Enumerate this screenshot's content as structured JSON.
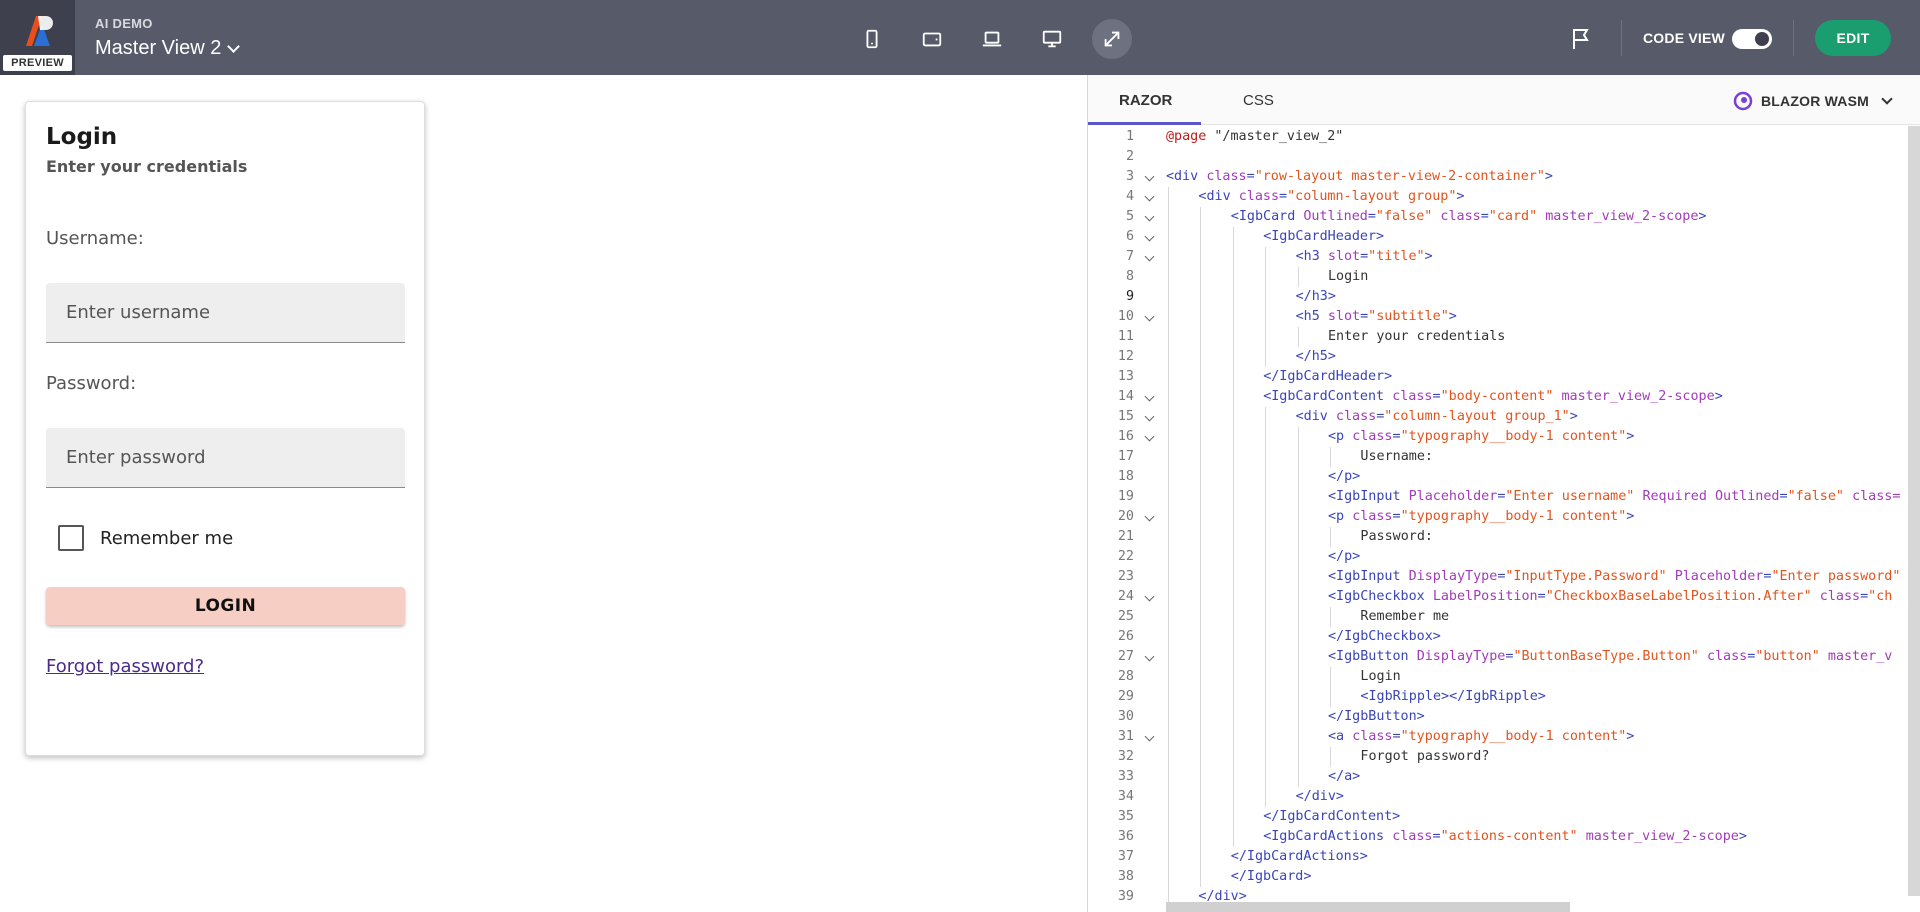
{
  "app": {
    "name": "AI DEMO",
    "view_title": "Master View 2",
    "badge": "PREVIEW"
  },
  "toolbar": {
    "devices": [
      "phone-icon",
      "tablet-icon",
      "laptop-icon",
      "desktop-icon",
      "fullscreen-icon"
    ],
    "active_device": "fullscreen-icon",
    "code_view_label": "CODE VIEW",
    "code_view_on": true,
    "edit_label": "EDIT"
  },
  "card": {
    "title": "Login",
    "subtitle": "Enter your credentials",
    "username_label": "Username:",
    "username_placeholder": "Enter username",
    "password_label": "Password:",
    "password_placeholder": "Enter password",
    "remember_label": "Remember me",
    "login_label": "LOGIN",
    "forgot_label": "Forgot password?"
  },
  "code": {
    "tabs": [
      {
        "label": "RAZOR",
        "active": true
      },
      {
        "label": "CSS",
        "active": false
      }
    ],
    "framework": "BLAZOR WASM",
    "current_line": 9,
    "lines": [
      {
        "n": 1,
        "indent": 0,
        "fold": false,
        "t": [
          [
            "dir",
            "@page"
          ],
          [
            "plain",
            " "
          ],
          [
            "plain",
            "\"/master_view_2\""
          ]
        ]
      },
      {
        "n": 2,
        "indent": 0,
        "fold": false,
        "t": []
      },
      {
        "n": 3,
        "indent": 0,
        "fold": true,
        "t": [
          [
            "tag",
            "<div "
          ],
          [
            "attr",
            "class"
          ],
          [
            "tag",
            "="
          ],
          [
            "str",
            "\"row-layout master-view-2-container\""
          ],
          [
            "tag",
            ">"
          ]
        ]
      },
      {
        "n": 4,
        "indent": 1,
        "fold": true,
        "t": [
          [
            "tag",
            "<div "
          ],
          [
            "attr",
            "class"
          ],
          [
            "tag",
            "="
          ],
          [
            "str",
            "\"column-layout group\""
          ],
          [
            "tag",
            ">"
          ]
        ]
      },
      {
        "n": 5,
        "indent": 2,
        "fold": true,
        "t": [
          [
            "tag",
            "<IgbCard "
          ],
          [
            "attr",
            "Outlined"
          ],
          [
            "tag",
            "="
          ],
          [
            "str",
            "\"false\""
          ],
          [
            "tag",
            " "
          ],
          [
            "attr",
            "class"
          ],
          [
            "tag",
            "="
          ],
          [
            "str",
            "\"card\""
          ],
          [
            "tag",
            " "
          ],
          [
            "attr",
            "master_view_2-scope"
          ],
          [
            "tag",
            ">"
          ]
        ]
      },
      {
        "n": 6,
        "indent": 3,
        "fold": true,
        "t": [
          [
            "tag",
            "<IgbCardHeader>"
          ]
        ]
      },
      {
        "n": 7,
        "indent": 4,
        "fold": true,
        "t": [
          [
            "tag",
            "<h3 "
          ],
          [
            "attr",
            "slot"
          ],
          [
            "tag",
            "="
          ],
          [
            "str",
            "\"title\""
          ],
          [
            "tag",
            ">"
          ]
        ]
      },
      {
        "n": 8,
        "indent": 5,
        "fold": false,
        "t": [
          [
            "plain",
            "Login"
          ]
        ]
      },
      {
        "n": 9,
        "indent": 4,
        "fold": false,
        "t": [
          [
            "tag",
            "</h3>"
          ]
        ]
      },
      {
        "n": 10,
        "indent": 4,
        "fold": true,
        "t": [
          [
            "tag",
            "<h5 "
          ],
          [
            "attr",
            "slot"
          ],
          [
            "tag",
            "="
          ],
          [
            "str",
            "\"subtitle\""
          ],
          [
            "tag",
            ">"
          ]
        ]
      },
      {
        "n": 11,
        "indent": 5,
        "fold": false,
        "t": [
          [
            "plain",
            "Enter your credentials"
          ]
        ]
      },
      {
        "n": 12,
        "indent": 4,
        "fold": false,
        "t": [
          [
            "tag",
            "</h5>"
          ]
        ]
      },
      {
        "n": 13,
        "indent": 3,
        "fold": false,
        "t": [
          [
            "tag",
            "</IgbCardHeader>"
          ]
        ]
      },
      {
        "n": 14,
        "indent": 3,
        "fold": true,
        "t": [
          [
            "tag",
            "<IgbCardContent "
          ],
          [
            "attr",
            "class"
          ],
          [
            "tag",
            "="
          ],
          [
            "str",
            "\"body-content\""
          ],
          [
            "tag",
            " "
          ],
          [
            "attr",
            "master_view_2-scope"
          ],
          [
            "tag",
            ">"
          ]
        ]
      },
      {
        "n": 15,
        "indent": 4,
        "fold": true,
        "t": [
          [
            "tag",
            "<div "
          ],
          [
            "attr",
            "class"
          ],
          [
            "tag",
            "="
          ],
          [
            "str",
            "\"column-layout group_1\""
          ],
          [
            "tag",
            ">"
          ]
        ]
      },
      {
        "n": 16,
        "indent": 5,
        "fold": true,
        "t": [
          [
            "tag",
            "<p "
          ],
          [
            "attr",
            "class"
          ],
          [
            "tag",
            "="
          ],
          [
            "str",
            "\"typography__body-1 content\""
          ],
          [
            "tag",
            ">"
          ]
        ]
      },
      {
        "n": 17,
        "indent": 6,
        "fold": false,
        "t": [
          [
            "plain",
            "Username:"
          ]
        ]
      },
      {
        "n": 18,
        "indent": 5,
        "fold": false,
        "t": [
          [
            "tag",
            "</p>"
          ]
        ]
      },
      {
        "n": 19,
        "indent": 5,
        "fold": false,
        "t": [
          [
            "tag",
            "<IgbInput "
          ],
          [
            "attr",
            "Placeholder"
          ],
          [
            "tag",
            "="
          ],
          [
            "str",
            "\"Enter username\""
          ],
          [
            "tag",
            " "
          ],
          [
            "attr",
            "Required"
          ],
          [
            "tag",
            " "
          ],
          [
            "attr",
            "Outlined"
          ],
          [
            "tag",
            "="
          ],
          [
            "str",
            "\"false\""
          ],
          [
            "tag",
            " "
          ],
          [
            "attr",
            "class="
          ]
        ]
      },
      {
        "n": 20,
        "indent": 5,
        "fold": true,
        "t": [
          [
            "tag",
            "<p "
          ],
          [
            "attr",
            "class"
          ],
          [
            "tag",
            "="
          ],
          [
            "str",
            "\"typography__body-1 content\""
          ],
          [
            "tag",
            ">"
          ]
        ]
      },
      {
        "n": 21,
        "indent": 6,
        "fold": false,
        "t": [
          [
            "plain",
            "Password:"
          ]
        ]
      },
      {
        "n": 22,
        "indent": 5,
        "fold": false,
        "t": [
          [
            "tag",
            "</p>"
          ]
        ]
      },
      {
        "n": 23,
        "indent": 5,
        "fold": false,
        "t": [
          [
            "tag",
            "<IgbInput "
          ],
          [
            "attr",
            "DisplayType"
          ],
          [
            "tag",
            "="
          ],
          [
            "str",
            "\"InputType.Password\""
          ],
          [
            "tag",
            " "
          ],
          [
            "attr",
            "Placeholder"
          ],
          [
            "tag",
            "="
          ],
          [
            "str",
            "\"Enter password\""
          ]
        ]
      },
      {
        "n": 24,
        "indent": 5,
        "fold": true,
        "t": [
          [
            "tag",
            "<IgbCheckbox "
          ],
          [
            "attr",
            "LabelPosition"
          ],
          [
            "tag",
            "="
          ],
          [
            "str",
            "\"CheckboxBaseLabelPosition.After\""
          ],
          [
            "tag",
            " "
          ],
          [
            "attr",
            "class"
          ],
          [
            "tag",
            "="
          ],
          [
            "str",
            "\"ch"
          ]
        ]
      },
      {
        "n": 25,
        "indent": 6,
        "fold": false,
        "t": [
          [
            "plain",
            "Remember me"
          ]
        ]
      },
      {
        "n": 26,
        "indent": 5,
        "fold": false,
        "t": [
          [
            "tag",
            "</IgbCheckbox>"
          ]
        ]
      },
      {
        "n": 27,
        "indent": 5,
        "fold": true,
        "t": [
          [
            "tag",
            "<IgbButton "
          ],
          [
            "attr",
            "DisplayType"
          ],
          [
            "tag",
            "="
          ],
          [
            "str",
            "\"ButtonBaseType.Button\""
          ],
          [
            "tag",
            " "
          ],
          [
            "attr",
            "class"
          ],
          [
            "tag",
            "="
          ],
          [
            "str",
            "\"button\""
          ],
          [
            "tag",
            " "
          ],
          [
            "attr",
            "master_v"
          ]
        ]
      },
      {
        "n": 28,
        "indent": 6,
        "fold": false,
        "t": [
          [
            "plain",
            "Login"
          ]
        ]
      },
      {
        "n": 29,
        "indent": 6,
        "fold": false,
        "t": [
          [
            "tag",
            "<IgbRipple></IgbRipple>"
          ]
        ]
      },
      {
        "n": 30,
        "indent": 5,
        "fold": false,
        "t": [
          [
            "tag",
            "</IgbButton>"
          ]
        ]
      },
      {
        "n": 31,
        "indent": 5,
        "fold": true,
        "t": [
          [
            "tag",
            "<a "
          ],
          [
            "attr",
            "class"
          ],
          [
            "tag",
            "="
          ],
          [
            "str",
            "\"typography__body-1 content\""
          ],
          [
            "tag",
            ">"
          ]
        ]
      },
      {
        "n": 32,
        "indent": 6,
        "fold": false,
        "t": [
          [
            "plain",
            "Forgot password?"
          ]
        ]
      },
      {
        "n": 33,
        "indent": 5,
        "fold": false,
        "t": [
          [
            "tag",
            "</a>"
          ]
        ]
      },
      {
        "n": 34,
        "indent": 4,
        "fold": false,
        "t": [
          [
            "tag",
            "</div>"
          ]
        ]
      },
      {
        "n": 35,
        "indent": 3,
        "fold": false,
        "t": [
          [
            "tag",
            "</IgbCardContent>"
          ]
        ]
      },
      {
        "n": 36,
        "indent": 3,
        "fold": false,
        "t": [
          [
            "tag",
            "<IgbCardActions "
          ],
          [
            "attr",
            "class"
          ],
          [
            "tag",
            "="
          ],
          [
            "str",
            "\"actions-content\""
          ],
          [
            "tag",
            " "
          ],
          [
            "attr",
            "master_view_2-scope"
          ],
          [
            "tag",
            ">"
          ]
        ]
      },
      {
        "n": 37,
        "indent": 2,
        "fold": false,
        "t": [
          [
            "tag",
            "</IgbCardActions>"
          ]
        ]
      },
      {
        "n": 38,
        "indent": 2,
        "fold": false,
        "t": [
          [
            "tag",
            "</IgbCard>"
          ]
        ]
      },
      {
        "n": 39,
        "indent": 1,
        "fold": false,
        "t": [
          [
            "tag",
            "</div>"
          ]
        ]
      }
    ]
  },
  "colors": {
    "topbar": "#575b69",
    "accent": "#5b57c9",
    "edit": "#1a9d6f",
    "login_button": "#f7cec3"
  }
}
